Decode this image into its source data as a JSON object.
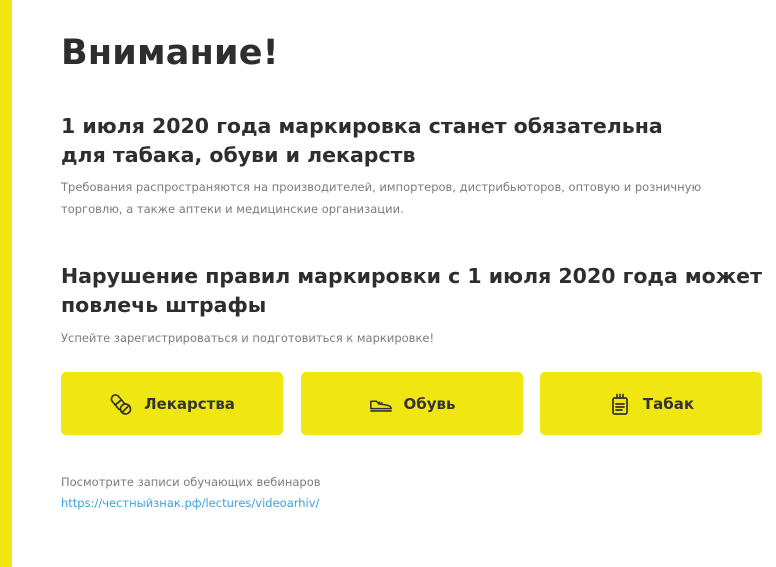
{
  "colors": {
    "accent": "#f0e611",
    "heading": "#2e2e2e",
    "muted_text": "#7b7b7b",
    "link": "#3ba3dc"
  },
  "page": {
    "title": "Внимание!"
  },
  "section1": {
    "heading_line1": "1 июля 2020 года маркировка станет обязательна",
    "heading_line2": "для табака, обуви и лекарств",
    "text_line1": "Требования распространяются на производителей, импортеров, дистрибьюторов, оптовую и розничную",
    "text_line2": "торговлю, а также аптеки и медицинские организации."
  },
  "section2": {
    "heading_line1": "Нарушение правил маркировки с 1 июля 2020 года может",
    "heading_line2": "повлечь штрафы",
    "text": "Успейте зарегистрироваться и подготовиться к маркировке!"
  },
  "categories": [
    {
      "label": "Лекарства",
      "icon": "pills-icon"
    },
    {
      "label": "Обувь",
      "icon": "sneaker-icon"
    },
    {
      "label": "Табак",
      "icon": "cigarette-pack-icon"
    }
  ],
  "webinars": {
    "caption": "Посмотрите записи обучающих вебинаров",
    "link_text": "https://честныйзнак.рф/lectures/videoarhiv/"
  }
}
